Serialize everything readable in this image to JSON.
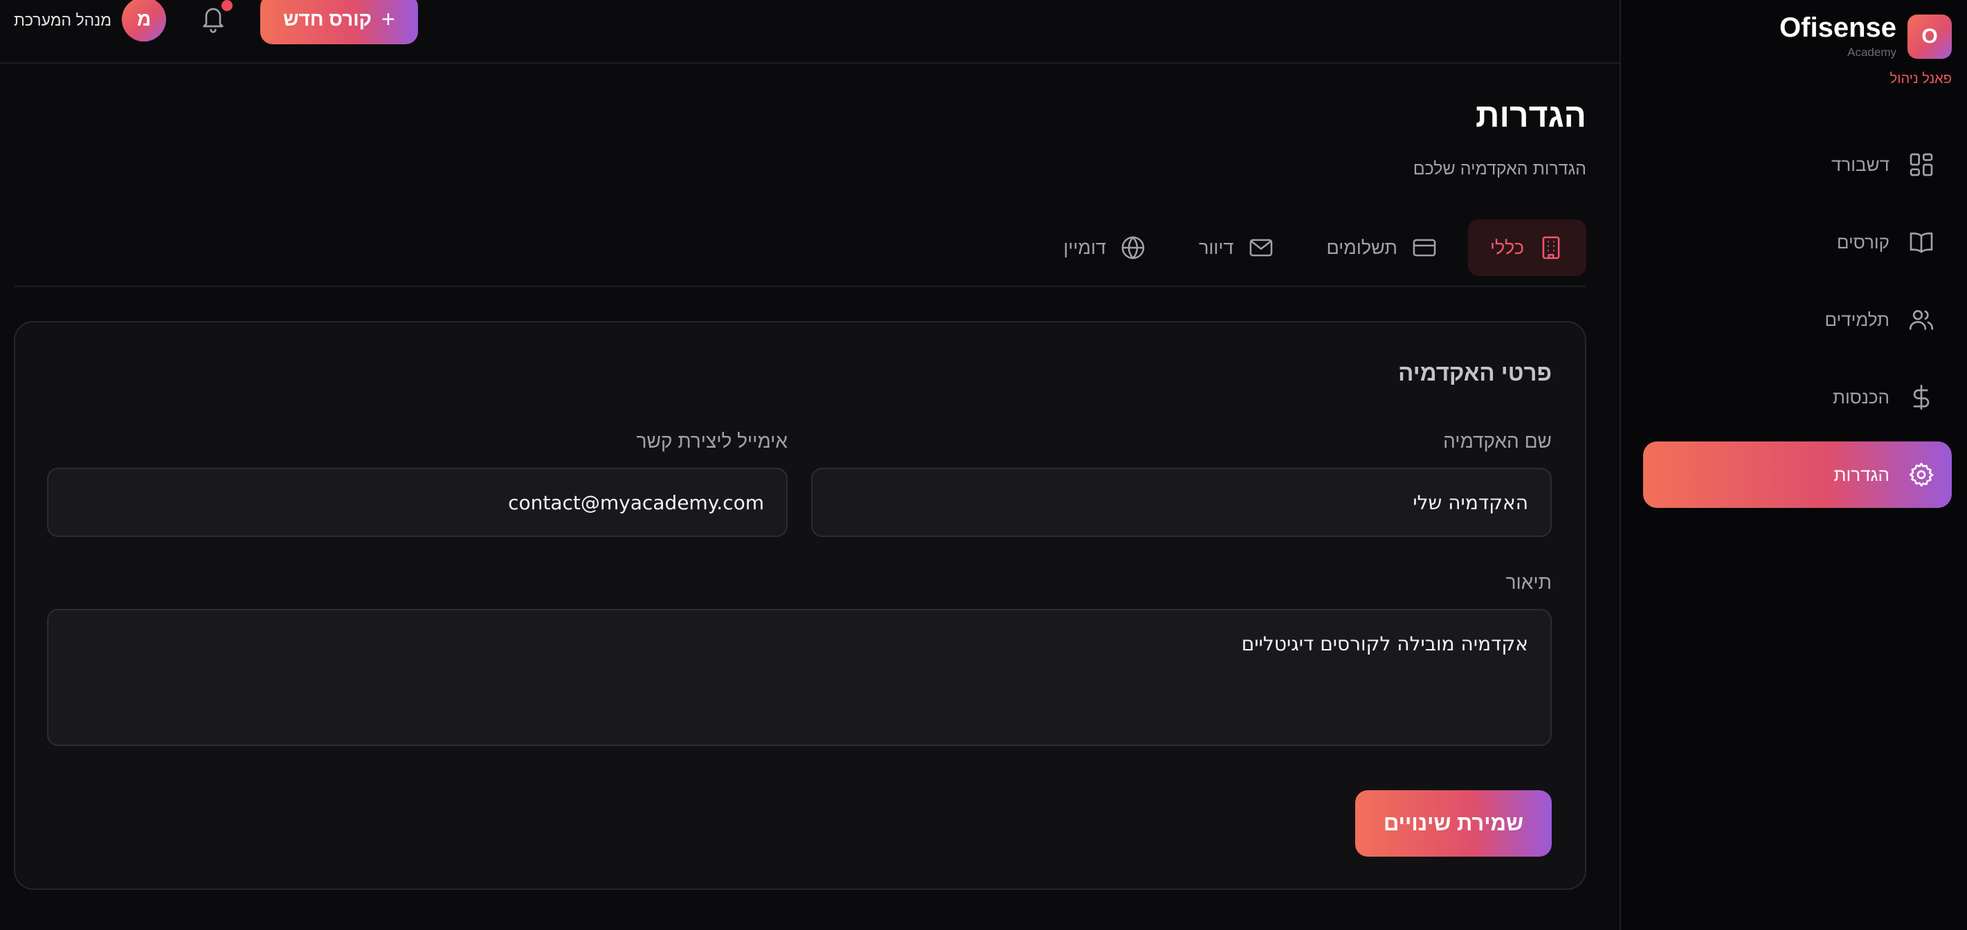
{
  "brand": {
    "logo_letter": "O",
    "name": "Ofisense",
    "sub": "Academy",
    "panel_label": "פאנל ניהול"
  },
  "sidebar": {
    "items": [
      {
        "label": "דשבורד",
        "icon": "dashboard-grid-icon"
      },
      {
        "label": "קורסים",
        "icon": "book-icon"
      },
      {
        "label": "תלמידים",
        "icon": "users-icon"
      },
      {
        "label": "הכנסות",
        "icon": "dollar-icon"
      },
      {
        "label": "הגדרות",
        "icon": "gear-icon",
        "active": true
      }
    ]
  },
  "header": {
    "admin_label": "מנהל המערכת",
    "avatar_letter": "מ",
    "notifications_icon": "bell-icon",
    "new_course_label": "קורס חדש",
    "new_course_icon": "plus-icon"
  },
  "page": {
    "title": "הגדרות",
    "subtitle": "הגדרות האקדמיה שלכם"
  },
  "tabs": [
    {
      "label": "כללי",
      "icon": "building-icon",
      "active": true
    },
    {
      "label": "תשלומים",
      "icon": "credit-card-icon"
    },
    {
      "label": "דיוור",
      "icon": "mail-icon"
    },
    {
      "label": "דומיין",
      "icon": "globe-icon"
    }
  ],
  "form": {
    "section_title": "פרטי האקדמיה",
    "academy_name": {
      "label": "שם האקדמיה",
      "value": "האקדמיה שלי"
    },
    "contact_email": {
      "label": "אימייל ליצירת קשר",
      "value": "contact@myacademy.com"
    },
    "description": {
      "label": "תיאור",
      "value": "אקדמיה מובילה לקורסים דיגיטליים"
    },
    "save_label": "שמירת שינויים"
  },
  "colors": {
    "accent_start": "#f2705a",
    "accent_mid": "#df4f6b",
    "accent_end": "#9b5ad8",
    "active_tab_text": "#f0566a",
    "background": "#0b0b0d"
  }
}
